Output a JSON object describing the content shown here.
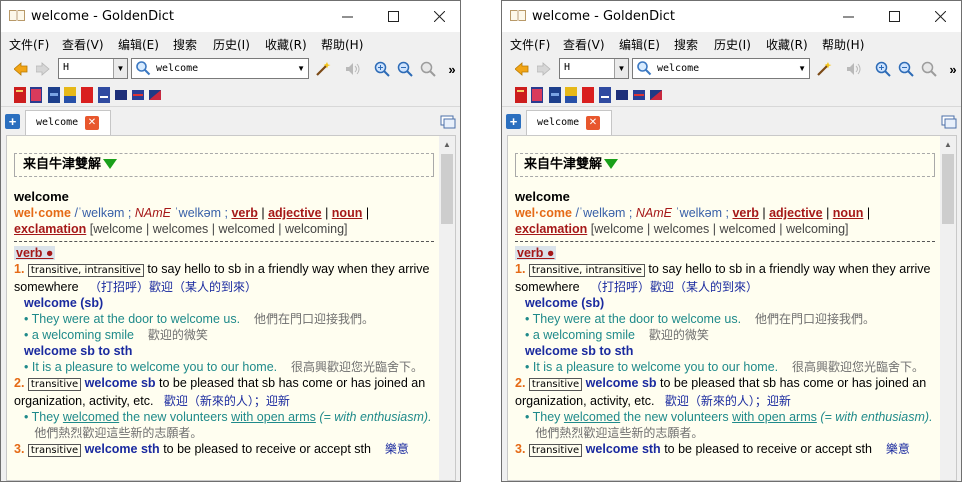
{
  "windows": [
    {
      "title": "welcome - GoldenDict",
      "menu": [
        "文件(F)",
        "查看(V)",
        "编辑(E)",
        "搜索",
        "历史(I)",
        "收藏(R)",
        "帮助(H)"
      ],
      "group_value": "H",
      "search_value": "welcome",
      "tab_label": "welcome",
      "dict_title": "来自牛津雙解",
      "headword": "welcome",
      "syllables": "wel·come",
      "pron_br": "/ˈwelkəm ;",
      "pron_am_label": "NAmE",
      "pron_am": "ˈwelkəm ;",
      "pos_links": [
        "verb",
        "adjective",
        "noun",
        "exclamation"
      ],
      "forms": "[welcome | welcomes | welcomed | welcoming]",
      "pos_heading": "verb ●",
      "s1_num": "1.",
      "s1_tag": "transitive, intransitive",
      "s1_def": "to say hello to sb in a friendly way when they arrive somewhere",
      "s1_cn": "（打招呼）歡迎（某人的到來）",
      "s1_phrase1": "welcome (sb)",
      "s1_ex1": "• They were at the door to welcome us.",
      "s1_ex1_cn": "他們在門口迎接我們。",
      "s1_ex2": "• a welcoming smile",
      "s1_ex2_cn": "歡迎的微笑",
      "s1_phrase2": "welcome sb to sth",
      "s1_ex3": "• It is a pleasure to welcome you to our home.",
      "s1_ex3_cn": "很高興歡迎您光臨舍下。",
      "s2_num": "2.",
      "s2_tag": "transitive",
      "s2_bold": "welcome sb",
      "s2_def": "to be pleased that sb has come or has joined an organization, activity, etc.",
      "s2_cn": "歡迎（新來的人）；迎新",
      "s2_ex_a": "• They",
      "s2_ex_b": "welcomed",
      "s2_ex_c": "the new volunteers",
      "s2_ex_d": "with open arms",
      "s2_ex_e": "(= with enthusiasm).",
      "s2_ex_cn": "他們熱烈歡迎這些新的志願者。",
      "s3_num": "3.",
      "s3_tag": "transitive",
      "s3_bold": "welcome sth",
      "s3_def": "to be pleased to receive or accept sth",
      "s3_cn": "樂意"
    },
    {
      "title": "welcome - GoldenDict",
      "menu": [
        "文件(F)",
        "查看(V)",
        "编辑(E)",
        "搜索",
        "历史(I)",
        "收藏(R)",
        "帮助(H)"
      ],
      "group_value": "H",
      "search_value": "welcome",
      "tab_label": "welcome",
      "dict_title": "来自牛津雙解",
      "headword": "welcome",
      "syllables": "wel·come",
      "pron_br": "/ˈwelkəm ;",
      "pron_am_label": "NAmE",
      "pron_am": "ˈwelkəm ;",
      "pos_links": [
        "verb",
        "adjective",
        "noun",
        "exclamation"
      ],
      "forms": "[welcome | welcomes | welcomed | welcoming]",
      "pos_heading": "verb ●",
      "s1_num": "1.",
      "s1_tag": "transitive, intransitive",
      "s1_def": "to say hello to sb in a friendly way when they arrive somewhere",
      "s1_cn": "（打招呼）歡迎（某人的到來）",
      "s1_phrase1": "welcome (sb)",
      "s1_ex1": "• They were at the door to welcome us.",
      "s1_ex1_cn": "他們在門口迎接我們。",
      "s1_ex2": "• a welcoming smile",
      "s1_ex2_cn": "歡迎的微笑",
      "s1_phrase2": "welcome sb to sth",
      "s1_ex3": "• It is a pleasure to welcome you to our home.",
      "s1_ex3_cn": "很高興歡迎您光臨舍下。",
      "s2_num": "2.",
      "s2_tag": "transitive",
      "s2_bold": "welcome sb",
      "s2_def": "to be pleased that sb has come or has joined an organization, activity, etc.",
      "s2_cn": "歡迎（新來的人）；迎新",
      "s2_ex_a": "• They",
      "s2_ex_b": "welcomed",
      "s2_ex_c": "the new volunteers",
      "s2_ex_d": "with open arms",
      "s2_ex_e": "(= with enthusiasm).",
      "s2_ex_cn": "他們熱烈歡迎這些新的志願者。",
      "s3_num": "3.",
      "s3_tag": "transitive",
      "s3_bold": "welcome sth",
      "s3_def": "to be pleased to receive or accept sth",
      "s3_cn": "樂意"
    }
  ],
  "icons": {
    "minimize": "minimize-icon",
    "maximize": "maximize-icon",
    "close": "close-icon",
    "back": "back-arrow-icon",
    "forward": "forward-arrow-icon",
    "search": "search-icon",
    "scan_wand": "magic-wand-icon",
    "pronounce": "speaker-icon",
    "zoom_in": "zoom-in-icon",
    "zoom_out": "zoom-out-icon",
    "zoom_reset": "zoom-reset-icon"
  }
}
